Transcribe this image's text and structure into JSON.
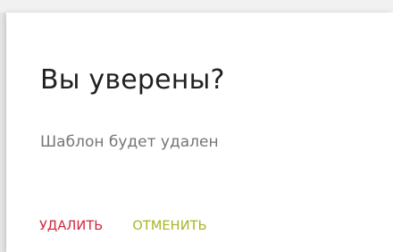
{
  "dialog": {
    "title": "Вы уверены?",
    "message": "Шаблон будет удален",
    "delete_label": "УДАЛИТЬ",
    "cancel_label": "ОТМЕНИТЬ"
  },
  "colors": {
    "delete": "#d0263b",
    "cancel": "#a6b422",
    "title": "#212121",
    "message": "#757575"
  }
}
